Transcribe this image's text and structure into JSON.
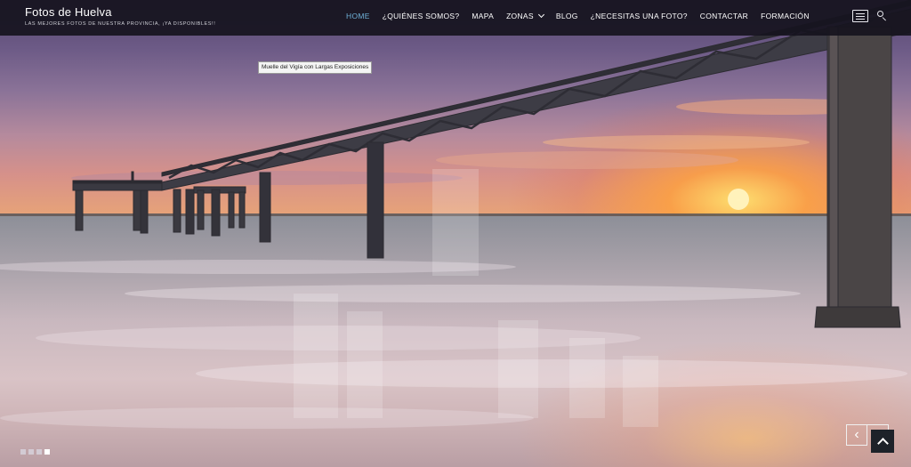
{
  "site": {
    "title": "Fotos de Huelva",
    "tagline": "LAS MEJORES FOTOS DE NUESTRA PROVINCIA, ¡YA DISPONIBLES!!"
  },
  "nav": {
    "items": [
      {
        "label": "HOME",
        "active": true
      },
      {
        "label": "¿QUIÉNES SOMOS?"
      },
      {
        "label": "MAPA"
      },
      {
        "label": "ZONAS",
        "dropdown": true
      },
      {
        "label": "BLOG"
      },
      {
        "label": "¿NECESITAS UNA FOTO?"
      },
      {
        "label": "CONTACTAR"
      },
      {
        "label": "FORMACIÓN"
      }
    ]
  },
  "header_icons": [
    "menu-icon",
    "search-icon"
  ],
  "slide": {
    "caption": "Muelle del Vigía con Largas Exposiciones",
    "count": 4,
    "active_index": 3
  },
  "controls": {
    "prev_symbol": "‹"
  },
  "colors": {
    "header_bg": "#16141e",
    "nav_active": "#6fb1d8",
    "back_to_top_bg": "#1d2229"
  }
}
